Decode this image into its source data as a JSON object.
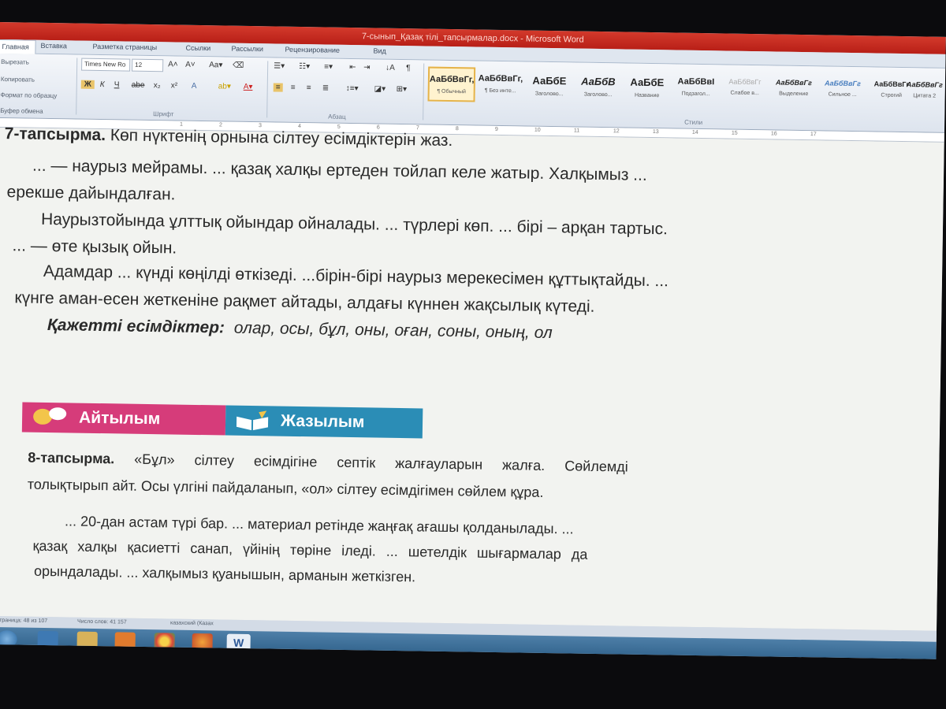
{
  "window": {
    "title": "7-сынып_Қазақ тілі_тапсырмалар.docx - Microsoft Word"
  },
  "ribbon": {
    "tabs": [
      "Главная",
      "Вставка",
      "Разметка страницы",
      "Ссылки",
      "Рассылки",
      "Рецензирование",
      "Вид"
    ],
    "clipboard": [
      "Вырезать",
      "Копировать",
      "Формат по образцу",
      "Буфер обмена"
    ],
    "font": {
      "name": "Times New Ro",
      "size": "12",
      "group_label": "Шрифт"
    },
    "paragraph_group_label": "Абзац",
    "styles_group_label": "Стили",
    "styles": [
      {
        "preview": "АаБбВвГг,",
        "name": "¶ Обычный"
      },
      {
        "preview": "АаБбВвГг,",
        "name": "¶ Без инте..."
      },
      {
        "preview": "АаБбЕ",
        "name": "Заголово..."
      },
      {
        "preview": "АаБбВ",
        "name": "Заголово..."
      },
      {
        "preview": "АаБбЕ",
        "name": "Название"
      },
      {
        "preview": "АаБбВвІ",
        "name": "Подзагол..."
      },
      {
        "preview": "АаБбВвГг",
        "name": "Слабое в..."
      },
      {
        "preview": "АаБбВвГг",
        "name": "Выделение"
      },
      {
        "preview": "АаБбВвГг",
        "name": "Сильное ..."
      },
      {
        "preview": "АаБбВвГг",
        "name": "Строгий"
      },
      {
        "preview": "АаБбВвГг",
        "name": "Цитата 2"
      }
    ]
  },
  "ruler": {
    "ticks": [
      "1",
      "2",
      "3",
      "4",
      "5",
      "6",
      "7",
      "8",
      "9",
      "10",
      "11",
      "12",
      "13",
      "14",
      "15",
      "16",
      "17"
    ]
  },
  "document": {
    "task7": {
      "heading": "7-тапсырма.",
      "instruction": "Көп нүктенің орнына сілтеу есімдіктерін жаз.",
      "lines": [
        "... — наурыз мейрамы. ... қазақ халқы ертеден тойлап келе жатыр. Халқымыз ...",
        "ерекше дайындалған.",
        "Наурызтойында ұлттық ойындар ойналады. ... түрлері көп. ... бірі – арқан тартыс.",
        "... — өте қызық ойын.",
        "Адамдар ... күнді көңілді өткізеді. ...бірін-бірі наурыз мерекесімен құттықтайды. ...",
        "күнге аман-есен жеткеніне рақмет айтады, алдағы күннен жақсылық күтеді."
      ],
      "needed_label": "Қажетті есімдіктер:",
      "needed_words": "олар, осы, бұл, оны, оған, соны, оның, ол"
    },
    "banner": {
      "speaking": "Айтылым",
      "writing": "Жазылым"
    },
    "task8": {
      "heading": "8-тапсырма.",
      "instruction_line1": "«Бұл» сілтеу есімдігіне септік жалғауларын жалға. Сөйлемді",
      "instruction_line2": "толықтырып айт. Осы үлгіні пайдаланып, «ол» сілтеу есімдігімен сөйлем құра.",
      "lines": [
        "... 20-дан астам түрі бар. ... материал ретінде жаңғақ ағашы қолданылады. ...",
        "қазақ халқы қасиетті санап, үйінің төріне іледі. ... шетелдік шығармалар да",
        "орындалады. ... халқымыз қуанышын, арманын жеткізген."
      ]
    }
  },
  "statusbar": {
    "left": "Страница: 48 из 107",
    "words": "Число слов: 41 157",
    "lang": "казахский (Казах"
  },
  "taskbar": {
    "icons": [
      "start-icon",
      "ie-icon",
      "folder-icon",
      "media-icon",
      "chrome-icon",
      "firefox-icon",
      "word-icon"
    ],
    "word_label": "W"
  }
}
